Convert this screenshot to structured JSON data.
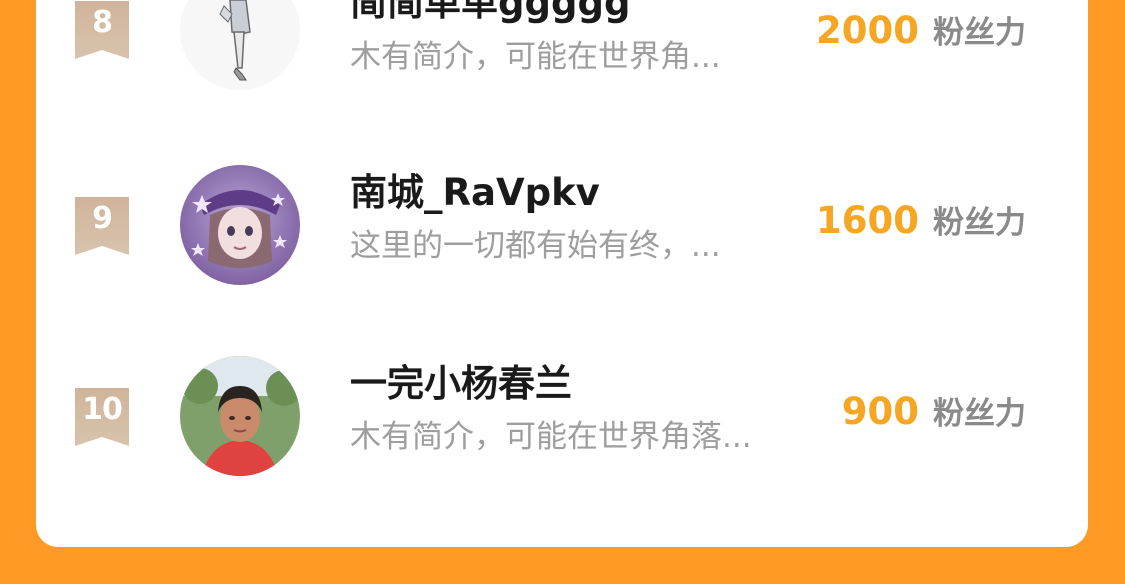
{
  "fans_label": "粉丝力",
  "colors": {
    "page_background": "#fe9a25",
    "card_background": "#ffffff",
    "fans_number": "#f5a623",
    "rank_badge": "#c8a98a"
  },
  "rows": [
    {
      "rank": "8",
      "name": "简简单单ggggg",
      "bio": "木有简介，可能在世界角...",
      "fans": "2000"
    },
    {
      "rank": "9",
      "name": "南城_RaVpkv",
      "bio": "这里的一切都有始有终，...",
      "fans": "1600"
    },
    {
      "rank": "10",
      "name": "一完小杨春兰",
      "bio": "木有简介，可能在世界角落...",
      "fans": "900"
    }
  ]
}
